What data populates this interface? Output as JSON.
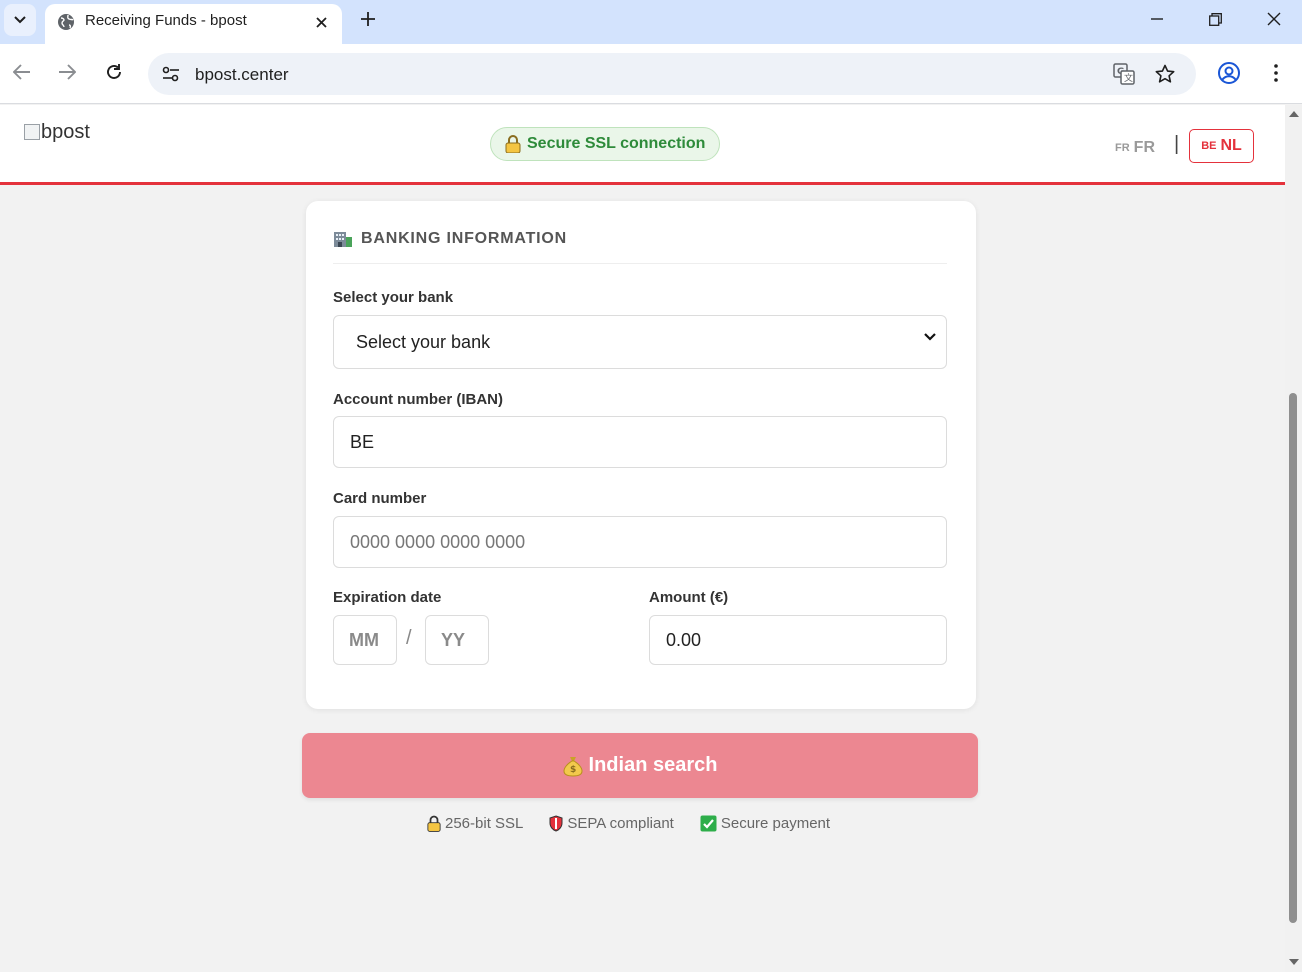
{
  "browser": {
    "tab_title": "Receiving Funds - bpost",
    "url": "bpost.center",
    "tab_icon": "globe-icon"
  },
  "header": {
    "logo_alt": "bpost",
    "ssl_label": "Secure SSL connection",
    "lang_fr_code": "FR",
    "lang_fr_label": "FR",
    "lang_separator": "|",
    "lang_nl_code": "BE",
    "lang_nl_label": "NL"
  },
  "form": {
    "section_title": "BANKING INFORMATION",
    "bank_label": "Select your bank",
    "bank_selected": "Select your bank",
    "iban_label": "Account number (IBAN)",
    "iban_value": "BE",
    "card_label": "Card number",
    "card_placeholder": "0000 0000 0000 0000",
    "expiry_label": "Expiration date",
    "expiry_month_placeholder": "MM",
    "expiry_separator": "/",
    "expiry_year_placeholder": "YY",
    "amount_label": "Amount (€)",
    "amount_value": "0.00"
  },
  "submit": {
    "label": "Indian search"
  },
  "badges": {
    "ssl": "256-bit SSL",
    "sepa": "SEPA compliant",
    "secure": "Secure payment"
  },
  "colors": {
    "brand_red": "#e4323c",
    "button_pink": "#ec8791",
    "ssl_green": "#2e8b3a"
  }
}
